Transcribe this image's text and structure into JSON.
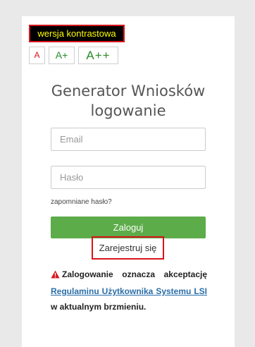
{
  "accessibility": {
    "contrast_label": "wersja kontrastowa",
    "font_small": "A",
    "font_medium": "A+",
    "font_large": "A++"
  },
  "login": {
    "title_line1": "Generator Wniosków",
    "title_line2": "logowanie",
    "email_placeholder": "Email",
    "password_placeholder": "Hasło",
    "forgot_password": "zapomniane hasło?",
    "login_button": "Zaloguj",
    "register_link": "Zarejestruj się"
  },
  "notice": {
    "icon": "warning-icon",
    "text_before": "Zalogowanie oznacza akceptację",
    "link_text": "Regulaminu Użytkownika Systemu LSI",
    "text_after": "w aktualnym brzmieniu."
  },
  "colors": {
    "primary_button": "#5cac49",
    "highlight_border": "#d8141a",
    "link": "#2a6ea8"
  }
}
